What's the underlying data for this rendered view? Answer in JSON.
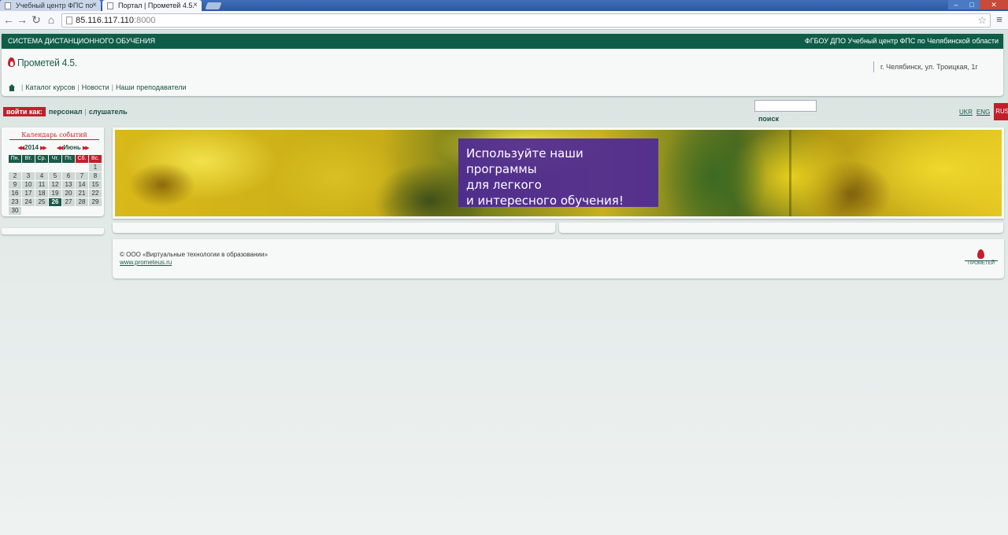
{
  "browser": {
    "tabs": [
      {
        "title": "Учебный центр ФПС по",
        "active": false
      },
      {
        "title": "Портал | Прометей 4.5.",
        "active": true
      }
    ],
    "url_host": "85.116.117.110",
    "url_port": ":8000",
    "icons": {
      "back": "arrow-left-icon",
      "forward": "arrow-right-icon",
      "reload": "reload-icon",
      "home": "home-icon",
      "bookmark": "star-icon",
      "menu": "hamburger-icon"
    }
  },
  "header": {
    "system_title": "СИСТЕМА ДИСТАНЦИОННОГО ОБУЧЕНИЯ",
    "organization": "ФГБОУ ДПО Учебный центр ФПС по Челябинской области",
    "logo_text": "Прометей 4.5.",
    "address": "г. Челябинск, ул. Троицкая, 1г",
    "nav": [
      "Каталог курсов",
      "Новости",
      "Наши преподаватели"
    ]
  },
  "login": {
    "label": "войти как:",
    "options": [
      "персонал",
      "слушатель"
    ]
  },
  "search": {
    "value": "",
    "label": "поиск"
  },
  "languages": [
    "UKR",
    "ENG",
    "RUS"
  ],
  "active_language": "RUS",
  "calendar": {
    "title": "Календарь событий",
    "year": "2014",
    "month": "Июнь",
    "weekdays": [
      "Пн.",
      "Вт.",
      "Ср.",
      "Чт.",
      "Пт.",
      "Сб.",
      "Вс."
    ],
    "today": "26",
    "days": [
      [
        "",
        "",
        "",
        "",
        "",
        "",
        "1"
      ],
      [
        "2",
        "3",
        "4",
        "5",
        "6",
        "7",
        "8"
      ],
      [
        "9",
        "10",
        "11",
        "12",
        "13",
        "14",
        "15"
      ],
      [
        "16",
        "17",
        "18",
        "19",
        "20",
        "21",
        "22"
      ],
      [
        "23",
        "24",
        "25",
        "26",
        "27",
        "28",
        "29"
      ],
      [
        "30",
        "",
        "",
        "",
        "",
        "",
        ""
      ]
    ]
  },
  "banner": {
    "lines": [
      "Используйте наши программы",
      "для легкого",
      "и интересного обучения!"
    ]
  },
  "footer": {
    "copyright": "© ООО «Виртуальные технологии в образовании»",
    "website": "www.prometeus.ru",
    "logo_text": "ПРОМЕТЕЙ"
  },
  "colors": {
    "brand_green": "#0e5d48",
    "brand_red": "#c21f2c",
    "banner_caption": "#4e2896"
  }
}
